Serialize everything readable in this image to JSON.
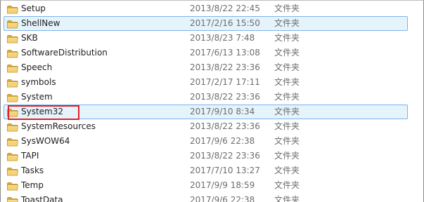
{
  "file_list": {
    "rows": [
      {
        "name": "Setup",
        "date": "2013/8/22 22:45",
        "type": "文件夹",
        "selected": false
      },
      {
        "name": "ShellNew",
        "date": "2017/2/16 15:50",
        "type": "文件夹",
        "selected": true
      },
      {
        "name": "SKB",
        "date": "2013/8/23 7:48",
        "type": "文件夹",
        "selected": false
      },
      {
        "name": "SoftwareDistribution",
        "date": "2017/6/13 13:08",
        "type": "文件夹",
        "selected": false
      },
      {
        "name": "Speech",
        "date": "2013/8/22 23:36",
        "type": "文件夹",
        "selected": false
      },
      {
        "name": "symbols",
        "date": "2017/2/17 17:11",
        "type": "文件夹",
        "selected": false
      },
      {
        "name": "System",
        "date": "2013/8/22 23:36",
        "type": "文件夹",
        "selected": false
      },
      {
        "name": "System32",
        "date": "2017/9/10 8:34",
        "type": "文件夹",
        "selected": true,
        "highlighted": true
      },
      {
        "name": "SystemResources",
        "date": "2013/8/22 23:36",
        "type": "文件夹",
        "selected": false
      },
      {
        "name": "SysWOW64",
        "date": "2017/9/6 22:38",
        "type": "文件夹",
        "selected": false
      },
      {
        "name": "TAPI",
        "date": "2013/8/22 23:36",
        "type": "文件夹",
        "selected": false
      },
      {
        "name": "Tasks",
        "date": "2017/7/10 13:27",
        "type": "文件夹",
        "selected": false
      },
      {
        "name": "Temp",
        "date": "2017/9/9 18:59",
        "type": "文件夹",
        "selected": false
      },
      {
        "name": "ToastData",
        "date": "2017/9/6 22:38",
        "type": "文件夹",
        "selected": false
      }
    ]
  },
  "colors": {
    "selection_fill": "#e5f3fb",
    "selection_border": "#7eb4ea",
    "annotation_red": "#e0202a",
    "folder_yellow": "#e8c05a"
  },
  "icons": {
    "row_icon": "folder-icon"
  }
}
